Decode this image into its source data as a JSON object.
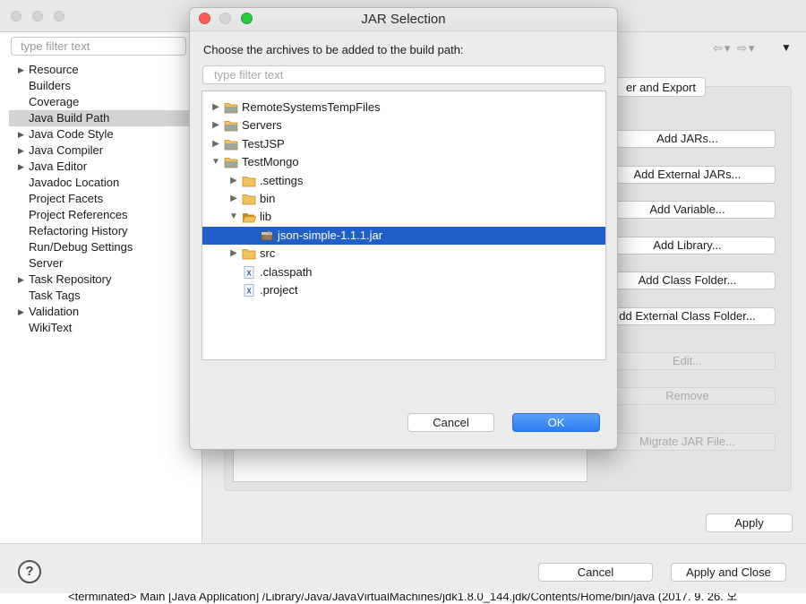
{
  "background": {
    "filter_placeholder": "type filter text",
    "categories": [
      {
        "label": "Resource",
        "expandable": true
      },
      {
        "label": "Builders",
        "expandable": false
      },
      {
        "label": "Coverage",
        "expandable": false
      },
      {
        "label": "Java Build Path",
        "expandable": false,
        "selected": true
      },
      {
        "label": "Java Code Style",
        "expandable": true
      },
      {
        "label": "Java Compiler",
        "expandable": true
      },
      {
        "label": "Java Editor",
        "expandable": true
      },
      {
        "label": "Javadoc Location",
        "expandable": false
      },
      {
        "label": "Project Facets",
        "expandable": false
      },
      {
        "label": "Project References",
        "expandable": false
      },
      {
        "label": "Refactoring History",
        "expandable": false
      },
      {
        "label": "Run/Debug Settings",
        "expandable": false
      },
      {
        "label": "Server",
        "expandable": false
      },
      {
        "label": "Task Repository",
        "expandable": true
      },
      {
        "label": "Task Tags",
        "expandable": false
      },
      {
        "label": "Validation",
        "expandable": true
      },
      {
        "label": "WikiText",
        "expandable": false
      }
    ],
    "tab_order_export_label": "er and Export",
    "side_buttons": [
      {
        "label": "Add JARs...",
        "enabled": true
      },
      {
        "label": "Add External JARs...",
        "enabled": true
      },
      {
        "label": "Add Variable...",
        "enabled": true
      },
      {
        "label": "Add Library...",
        "enabled": true
      },
      {
        "label": "Add Class Folder...",
        "enabled": true
      },
      {
        "label": "dd External Class Folder...",
        "enabled": true
      },
      {
        "label": "Edit...",
        "enabled": false
      },
      {
        "label": "Remove",
        "enabled": false
      },
      {
        "label": "Migrate JAR File...",
        "enabled": false
      }
    ],
    "apply_label": "Apply",
    "cancel_label": "Cancel",
    "apply_close_label": "Apply and Close",
    "help_glyph": "?",
    "console_text": "<terminated> Main [Java Application] /Library/Java/JavaVirtualMachines/jdk1.8.0_144.jdk/Contents/Home/bin/java (2017. 9. 26. 오"
  },
  "dialog": {
    "title": "JAR Selection",
    "message": "Choose the archives to be added to the build path:",
    "filter_placeholder": "type filter text",
    "tree": [
      {
        "label": "RemoteSystemsTempFiles",
        "level": 0,
        "type": "project",
        "state": "collapsed"
      },
      {
        "label": "Servers",
        "level": 0,
        "type": "project",
        "state": "collapsed"
      },
      {
        "label": "TestJSP",
        "level": 0,
        "type": "project",
        "state": "collapsed"
      },
      {
        "label": "TestMongo",
        "level": 0,
        "type": "project",
        "state": "expanded"
      },
      {
        "label": ".settings",
        "level": 1,
        "type": "folder",
        "state": "collapsed"
      },
      {
        "label": "bin",
        "level": 1,
        "type": "folder",
        "state": "collapsed"
      },
      {
        "label": "lib",
        "level": 1,
        "type": "folder",
        "state": "expanded"
      },
      {
        "label": "json-simple-1.1.1.jar",
        "level": 2,
        "type": "jar",
        "state": "leaf",
        "selected": true
      },
      {
        "label": "src",
        "level": 1,
        "type": "folder",
        "state": "collapsed"
      },
      {
        "label": ".classpath",
        "level": 1,
        "type": "xml",
        "state": "leaf"
      },
      {
        "label": ".project",
        "level": 1,
        "type": "xml",
        "state": "leaf"
      }
    ],
    "cancel_label": "Cancel",
    "ok_label": "OK"
  },
  "colors": {
    "selection": "#1f5fc8",
    "ok_button": "#2b7cf2",
    "close_light": "#fc5f57",
    "max_light": "#2ac840",
    "folder": "#e0a83a"
  }
}
